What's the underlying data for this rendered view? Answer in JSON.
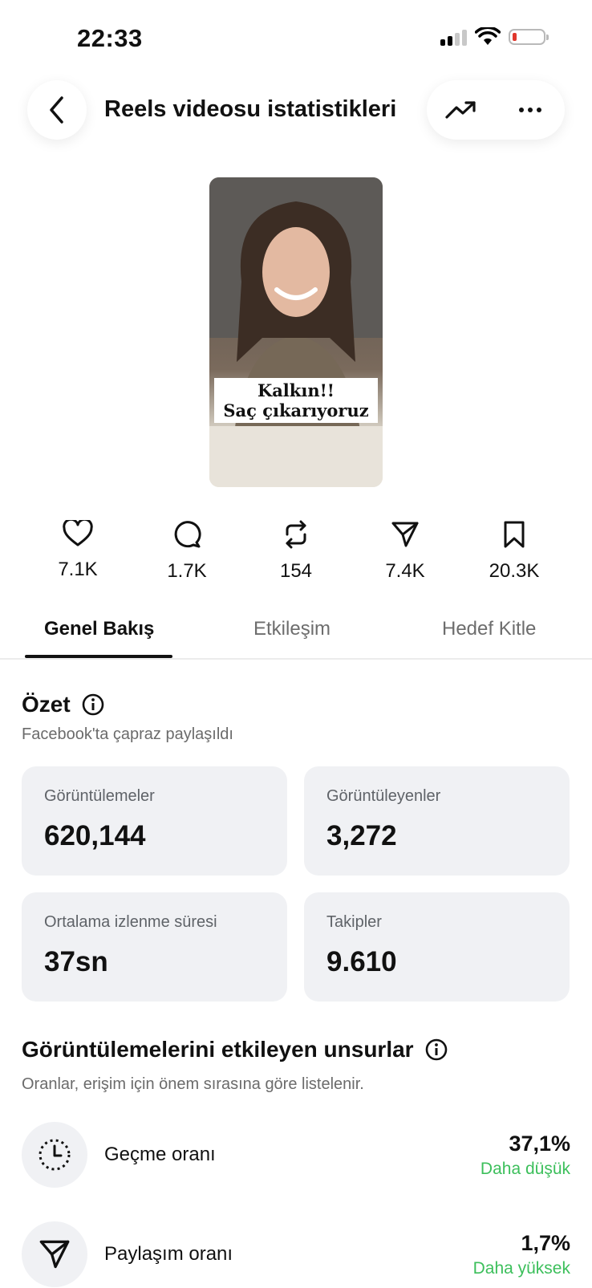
{
  "status_bar": {
    "time": "22:33"
  },
  "header": {
    "title": "Reels videosu istatistikleri"
  },
  "thumbnail": {
    "caption_line1": "Kalkın!!",
    "caption_line2": "Saç çıkarıyoruz"
  },
  "stats": [
    {
      "icon": "heart-icon",
      "value": "7.1K"
    },
    {
      "icon": "comment-icon",
      "value": "1.7K"
    },
    {
      "icon": "repost-icon",
      "value": "154"
    },
    {
      "icon": "share-icon",
      "value": "7.4K"
    },
    {
      "icon": "bookmark-icon",
      "value": "20.3K"
    }
  ],
  "tabs": [
    {
      "label": "Genel Bakış",
      "active": true
    },
    {
      "label": "Etkileşim",
      "active": false
    },
    {
      "label": "Hedef Kitle",
      "active": false
    }
  ],
  "summary": {
    "title": "Özet",
    "subtitle": "Facebook'ta çapraz paylaşıldı",
    "cards": [
      {
        "label": "Görüntülemeler",
        "value": "620,144"
      },
      {
        "label": "Görüntüleyenler",
        "value": "3,272"
      },
      {
        "label": "Ortalama izlenme süresi",
        "value": "37sn"
      },
      {
        "label": "Takipler",
        "value": "9.610"
      }
    ]
  },
  "factors": {
    "title": "Görüntülemelerini etkileyen unsurlar",
    "subtitle": "Oranlar, erişim için önem sırasına göre listelenir.",
    "items": [
      {
        "icon": "timer-icon",
        "label": "Geçme oranı",
        "value": "37,1%",
        "comparison": "Daha düşük"
      },
      {
        "icon": "share-icon",
        "label": "Paylaşım oranı",
        "value": "1,7%",
        "comparison": "Daha yüksek"
      }
    ]
  },
  "colors": {
    "positive": "#3cbf5b",
    "card_bg": "#f0f1f4"
  }
}
